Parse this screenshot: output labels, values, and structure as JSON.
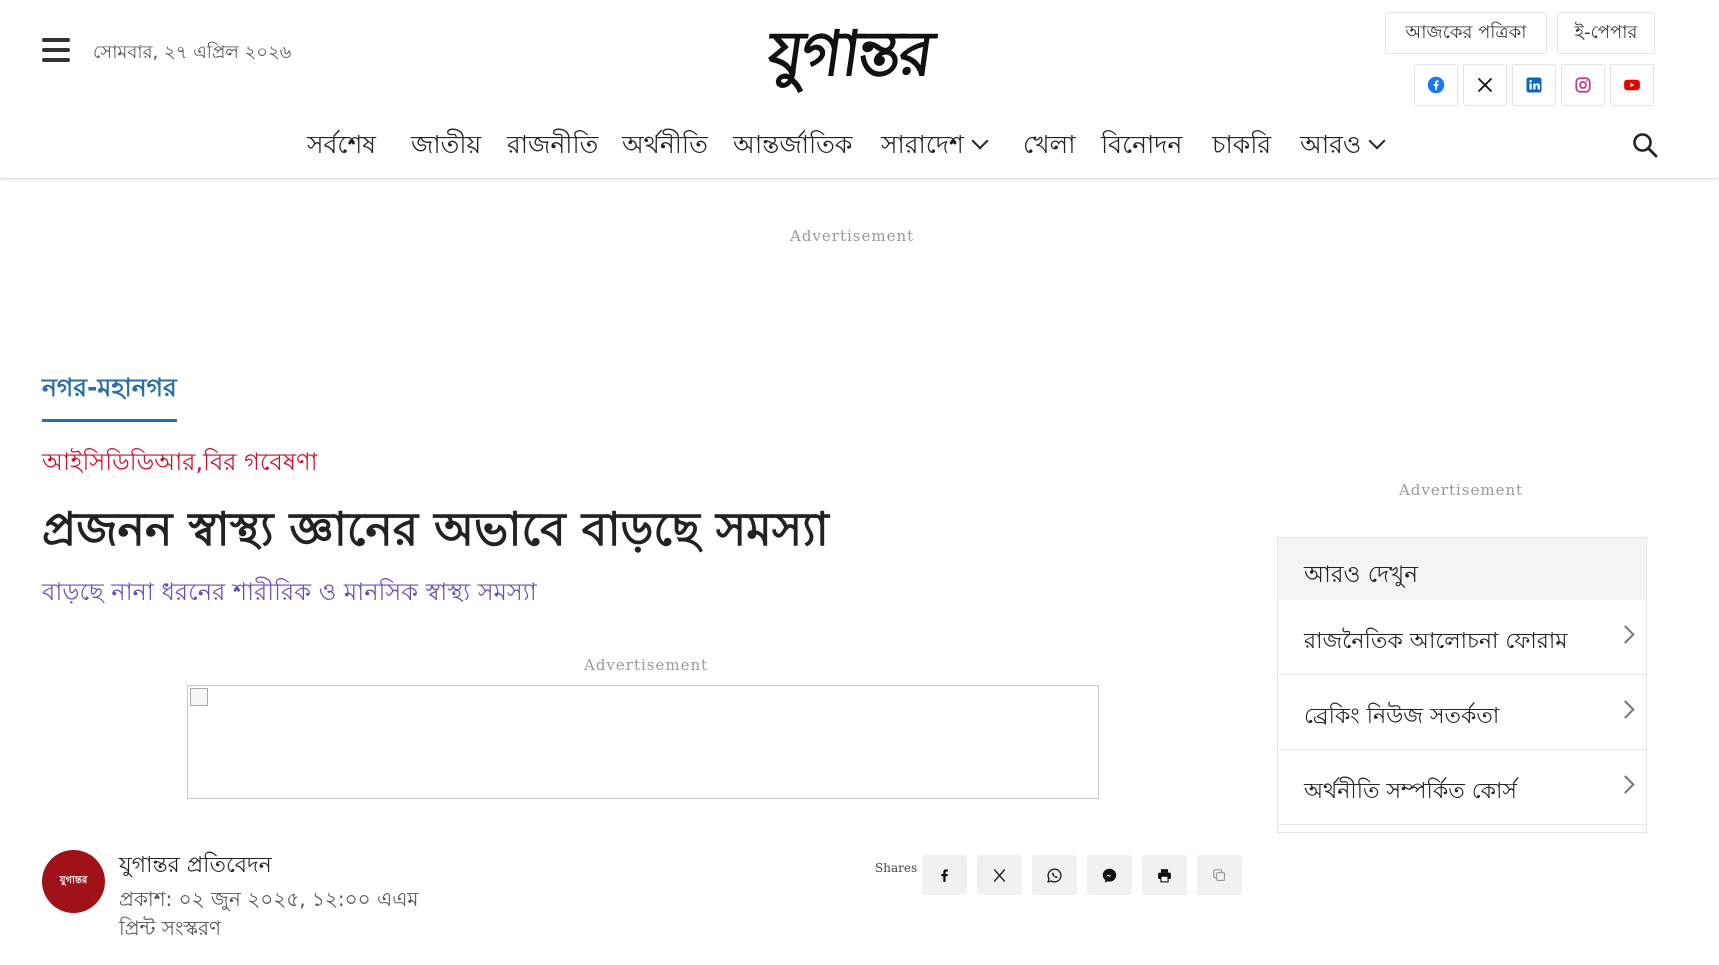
{
  "header": {
    "date": "সোমবার, ২৭ এপ্রিল ২০২৬",
    "logo_text": "যুগান্তর",
    "todays_paper": "আজকের পত্রিকা",
    "epaper": "ই-পেপার",
    "social_icons": [
      "facebook-icon",
      "x-icon",
      "linkedin-icon",
      "instagram-icon",
      "youtube-icon"
    ]
  },
  "nav": {
    "items": [
      {
        "label": "সর্বশেষ"
      },
      {
        "label": "জাতীয়"
      },
      {
        "label": "রাজনীতি"
      },
      {
        "label": "অর্থনীতি"
      },
      {
        "label": "আন্তর্জাতিক"
      },
      {
        "label": "সারাদেশ"
      },
      {
        "label": "খেলা"
      },
      {
        "label": "বিনোদন"
      },
      {
        "label": "চাকরি"
      },
      {
        "label": "আরও"
      }
    ]
  },
  "ads": {
    "label": "Advertisement"
  },
  "article": {
    "category": "নগর-মহানগর",
    "shoulder": "আইসিডিডিআর,বির গবেষণা",
    "headline": "প্রজনন স্বাস্থ্য জ্ঞানের অভাবে বাড়ছে সমস্যা",
    "subheadline": "বাড়ছে নানা ধরনের শারীরিক ও মানসিক স্বাস্থ্য সমস্যা",
    "author": "যুগান্তর প্রতিবেদন",
    "avatar_text": "যুগান্তর",
    "published": "প্রকাশ: ০২ জুন ২০২৫, ১২:০০ এএম",
    "print_edition": "প্রিন্ট সংস্করণ"
  },
  "share": {
    "label": "Shares",
    "icons": [
      "facebook-icon",
      "x-icon",
      "whatsapp-icon",
      "messenger-icon",
      "print-icon",
      "copy-icon"
    ]
  },
  "sidebar": {
    "title": "আরও দেখুন",
    "items": [
      {
        "label": "রাজনৈতিক আলোচনা ফোরাম"
      },
      {
        "label": "ব্রেকিং নিউজ সতর্কতা"
      },
      {
        "label": "অর্থনীতি সম্পর্কিত কোর্স"
      }
    ]
  },
  "colors": {
    "category": "#2a6fa8",
    "shoulder": "#c8102e",
    "subheadline": "#6a4fb8",
    "facebook": "#1877f2",
    "linkedin": "#0a66c2",
    "instagram": "#c13584",
    "youtube": "#e60000"
  }
}
